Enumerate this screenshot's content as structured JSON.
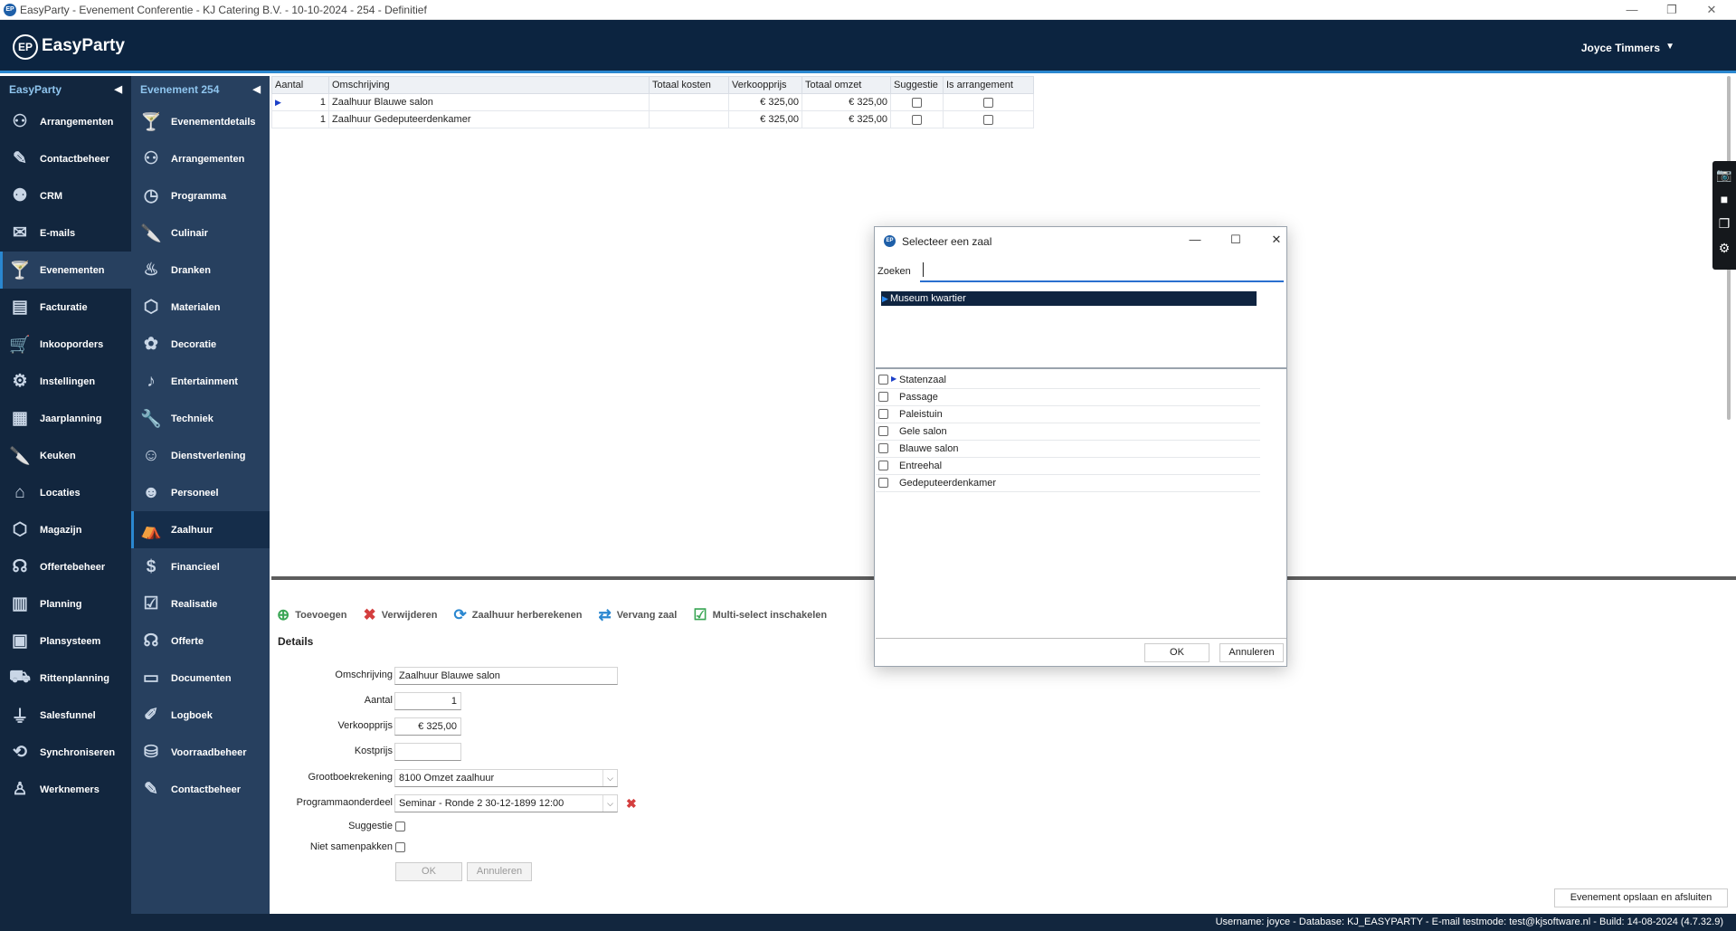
{
  "window": {
    "title": "EasyParty - Evenement Conferentie - KJ Catering B.V. - 10-10-2024 - 254 - Definitief",
    "app_icon": "EP"
  },
  "header": {
    "logo_badge": "EP",
    "logo_text": "EasyParty",
    "user": "Joyce Timmers"
  },
  "sidebar_main": {
    "title": "EasyParty",
    "items": [
      {
        "label": "Arrangementen",
        "icon": "people-icon"
      },
      {
        "label": "Contactbeheer",
        "icon": "edit-icon"
      },
      {
        "label": "CRM",
        "icon": "group-icon"
      },
      {
        "label": "E-mails",
        "icon": "mail-icon"
      },
      {
        "label": "Evenementen",
        "icon": "cocktail-icon",
        "active": true
      },
      {
        "label": "Facturatie",
        "icon": "invoice-icon"
      },
      {
        "label": "Inkooporders",
        "icon": "cart-icon"
      },
      {
        "label": "Instellingen",
        "icon": "gear-icon"
      },
      {
        "label": "Jaarplanning",
        "icon": "calendar-icon"
      },
      {
        "label": "Keuken",
        "icon": "knife-icon"
      },
      {
        "label": "Locaties",
        "icon": "building-icon"
      },
      {
        "label": "Magazijn",
        "icon": "box-icon"
      },
      {
        "label": "Offertebeheer",
        "icon": "offer-icon"
      },
      {
        "label": "Planning",
        "icon": "planning-icon"
      },
      {
        "label": "Plansysteem",
        "icon": "plan-icon"
      },
      {
        "label": "Rittenplanning",
        "icon": "truck-icon"
      },
      {
        "label": "Salesfunnel",
        "icon": "funnel-icon"
      },
      {
        "label": "Synchroniseren",
        "icon": "sync-icon"
      },
      {
        "label": "Werknemers",
        "icon": "employee-icon"
      }
    ]
  },
  "sidebar_event": {
    "title": "Evenement 254",
    "items": [
      {
        "label": "Evenementdetails",
        "icon": "cocktail-icon"
      },
      {
        "label": "Arrangementen",
        "icon": "people-icon"
      },
      {
        "label": "Programma",
        "icon": "clock-icon"
      },
      {
        "label": "Culinair",
        "icon": "knife-icon"
      },
      {
        "label": "Dranken",
        "icon": "drinks-icon"
      },
      {
        "label": "Materialen",
        "icon": "box-icon"
      },
      {
        "label": "Decoratie",
        "icon": "flower-icon"
      },
      {
        "label": "Entertainment",
        "icon": "entertainment-icon"
      },
      {
        "label": "Techniek",
        "icon": "wrench-icon"
      },
      {
        "label": "Dienstverlening",
        "icon": "service-icon"
      },
      {
        "label": "Personeel",
        "icon": "staff-icon"
      },
      {
        "label": "Zaalhuur",
        "icon": "tent-icon",
        "active": true
      },
      {
        "label": "Financieel",
        "icon": "money-icon"
      },
      {
        "label": "Realisatie",
        "icon": "check-list-icon"
      },
      {
        "label": "Offerte",
        "icon": "offer-icon"
      },
      {
        "label": "Documenten",
        "icon": "documents-icon"
      },
      {
        "label": "Logboek",
        "icon": "log-icon"
      },
      {
        "label": "Voorraadbeheer",
        "icon": "stock-icon"
      },
      {
        "label": "Contactbeheer",
        "icon": "edit-icon"
      }
    ]
  },
  "grid": {
    "columns": [
      "Aantal",
      "Omschrijving",
      "Totaal kosten",
      "Verkoopprijs",
      "Totaal omzet",
      "Suggestie",
      "Is arrangement"
    ],
    "rows": [
      {
        "aantal": "1",
        "omschrijving": "Zaalhuur Blauwe salon",
        "kosten": "",
        "verkoopprijs": "€ 325,00",
        "omzet": "€ 325,00",
        "suggestie": false,
        "arrangement": false
      },
      {
        "aantal": "1",
        "omschrijving": "Zaalhuur Gedeputeerdenkamer",
        "kosten": "",
        "verkoopprijs": "€ 325,00",
        "omzet": "€ 325,00",
        "suggestie": false,
        "arrangement": false
      }
    ]
  },
  "toolbar": {
    "add": "Toevoegen",
    "delete": "Verwijderen",
    "recalc": "Zaalhuur herberekenen",
    "replace": "Vervang zaal",
    "multiselect": "Multi-select inschakelen"
  },
  "details": {
    "title": "Details",
    "omschrijving_label": "Omschrijving",
    "omschrijving_value": "Zaalhuur Blauwe salon",
    "aantal_label": "Aantal",
    "aantal_value": "1",
    "verkoopprijs_label": "Verkoopprijs",
    "verkoopprijs_value": "€ 325,00",
    "kostprijs_label": "Kostprijs",
    "kostprijs_value": "",
    "grootboek_label": "Grootboekrekening",
    "grootboek_value": "8100 Omzet zaalhuur",
    "programma_label": "Programmaonderdeel",
    "programma_value": "Seminar - Ronde 2 30-12-1899 12:00",
    "suggestie_label": "Suggestie",
    "niet_samenpakken_label": "Niet samenpakken",
    "ok": "OK",
    "cancel": "Annuleren"
  },
  "save_close": "Evenement opslaan en afsluiten",
  "status": "Username: joyce - Database: KJ_EASYPARTY - E-mail testmode: test@kjsoftware.nl - Build: 14-08-2024 (4.7.32.9)",
  "dialog": {
    "title": "Selecteer een zaal",
    "icon_badge": "EP",
    "search_label": "Zoeken",
    "search_value": "",
    "selected_location": "Museum kwartier",
    "rooms": [
      "Statenzaal",
      "Passage",
      "Paleistuin",
      "Gele salon",
      "Blauwe salon",
      "Entreehal",
      "Gedeputeerdenkamer"
    ],
    "ok": "OK",
    "cancel": "Annuleren"
  },
  "colors": {
    "header_bg": "#0c2440",
    "sidebar_main_bg": "#12263e",
    "sidebar_event_bg": "#27405f",
    "accent": "#2a87d0",
    "selected_row": "#0f2440",
    "delete_red": "#d43e3e"
  }
}
